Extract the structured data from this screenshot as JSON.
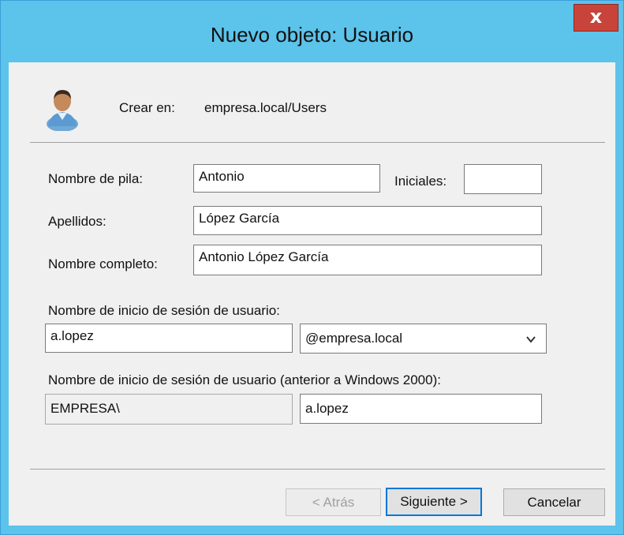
{
  "window": {
    "title": "Nuevo objeto: Usuario",
    "close_glyph": "x"
  },
  "header": {
    "icon": "user-icon",
    "create_in_label": "Crear en:",
    "create_in_value": "empresa.local/Users"
  },
  "form": {
    "first_name_label": "Nombre de pila:",
    "first_name_value": "Antonio",
    "initials_label": "Iniciales:",
    "initials_value": "",
    "last_name_label": "Apellidos:",
    "last_name_value": "López García",
    "full_name_label": "Nombre completo:",
    "full_name_value": "Antonio López García",
    "logon_name_label": "Nombre de inicio de sesión de usuario:",
    "logon_name_value": "a.lopez",
    "domain_selected": "@empresa.local",
    "pre2000_label": "Nombre de inicio de sesión de usuario (anterior a Windows 2000):",
    "pre2000_domain": "EMPRESA\\",
    "pre2000_value": "a.lopez"
  },
  "buttons": {
    "back": "< Atrás",
    "next": "Siguiente >",
    "cancel": "Cancelar"
  },
  "colors": {
    "titlebar": "#5cc3ea",
    "close_button": "#c8443a",
    "default_button_border": "#0078d7"
  }
}
